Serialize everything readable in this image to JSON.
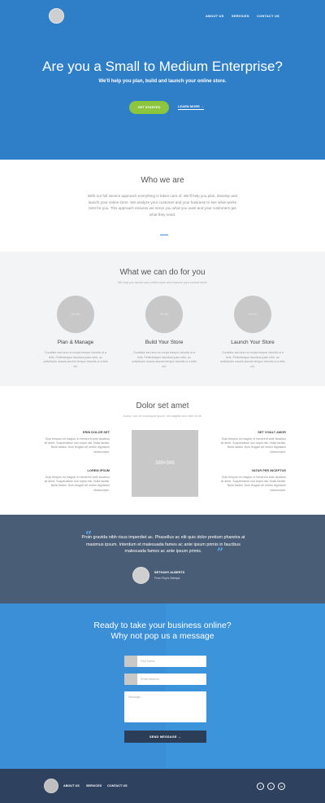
{
  "nav": {
    "about": "ABOUT US",
    "services": "SERVICES",
    "contact": "CONTACT US"
  },
  "hero": {
    "title": "Are you a Small to Medium Enterprise?",
    "subtitle": "We'll help you plan, build and launch your online store.",
    "cta_primary": "GET STARTED",
    "cta_secondary": "LEARN MORE →"
  },
  "who": {
    "title": "Who we are",
    "body": "With our full service approach everything is taken care of. We'll help you plan, develop and launch your online store. We analyze your customer and your business to see what works best for you. This approach ensures we serve you what you want and your customers get what they need."
  },
  "services": {
    "title": "What we can do for you",
    "subtitle": "We help you launch your online store and improve your current store!",
    "cards": [
      {
        "image": "96×96",
        "title": "Plan & Manage",
        "text": "Curabitur sed arcu eu turpis tempor lobortis ut a felis. Pellentesque faucibus justo nibh, ac sollicitudin mauris laoreet tempor lobortis ut a felis vel."
      },
      {
        "image": "96×96",
        "title": "Build Your Store",
        "text": "Curabitur sed arcu eu turpis tempor lobortis ut a felis. Pellentesque faucibus justo nibh, ac sollicitudin mauris laoreet tempor lobortis ut a felis vel."
      },
      {
        "image": "96×96",
        "title": "Launch Your Store",
        "text": "Curabitur sed arcu eu turpis tempor lobortis ut a felis. Pellentesque faucibus justo nibh, ac sollicitudin mauris laoreet tempor lobortis ut a felis vel."
      }
    ]
  },
  "features": {
    "title": "Dolor set amet",
    "subtitle": "Auctor, nisl vel consequat ipsum, nec sagittis sem nibh id elit.",
    "image": "300×300",
    "items": [
      {
        "title": "ERIN DOLOR SET",
        "text": "Duis tempus mi magna, in hendrerit ante faucibus sit amet. Suspendisse non turpis nisl. Nulla facilisi. Nulla facilisi. Duis feugiat vel metus dignissim ullamcorper."
      },
      {
        "title": "LOREM IPSUM",
        "text": "Duis tempus mi magna, in hendrerit ante faucibus sit amet. Suspendisse non turpis nisl. Nulla facilisi. Nulla facilisi. Duis feugiat vel metus dignissim ullamcorper."
      },
      {
        "title": "SET VIVALT AMOR",
        "text": "Duis tempus mi magna, in hendrerit ante faucibus sit amet. Suspendisse non turpis nisl. Nulla facilisi. Nulla facilisi. Duis feugiat vel metus dignissim ullamcorper."
      },
      {
        "title": "VATAR PER INCEPTUS",
        "text": "Duis tempus mi magna, in hendrerit ante faucibus sit amet. Suspendisse non turpis nisl. Nulla facilisi. Nulla facilisi. Duis feugiat vel metus dignissim ullamcorper."
      }
    ]
  },
  "testimonial": {
    "quote": "Proin gravida nibh risus imperdiet ac. Phasellus ac elit quis dolor pretium pharetra at maximus ipsum. Interdum et malesuada fames ac ante ipsum primis in faucibus malesuada fames ac ante ipsum primis.",
    "open_mark": "“",
    "close_mark": "”",
    "name": "BETHANY ALBERTS",
    "role": "From Roy's Stamps"
  },
  "contact": {
    "title_line1": "Ready to take your business online?",
    "title_line2": "Why not pop us a message",
    "name_placeholder": "First Name",
    "email_placeholder": "Email Address",
    "message_placeholder": "Message...",
    "send_label": "SEND MESSAGE →"
  },
  "footer": {
    "about": "ABOUT US",
    "services": "SERVICES",
    "contact": "CONTACT US",
    "social": [
      "f",
      "t",
      "in"
    ]
  },
  "colors": {
    "hero": "#2f7fc8",
    "accent_green": "#8cc63f",
    "quote_bg": "#4a5d76",
    "contact_bg": "#3a8fd6",
    "footer_bg": "#2e4260"
  }
}
